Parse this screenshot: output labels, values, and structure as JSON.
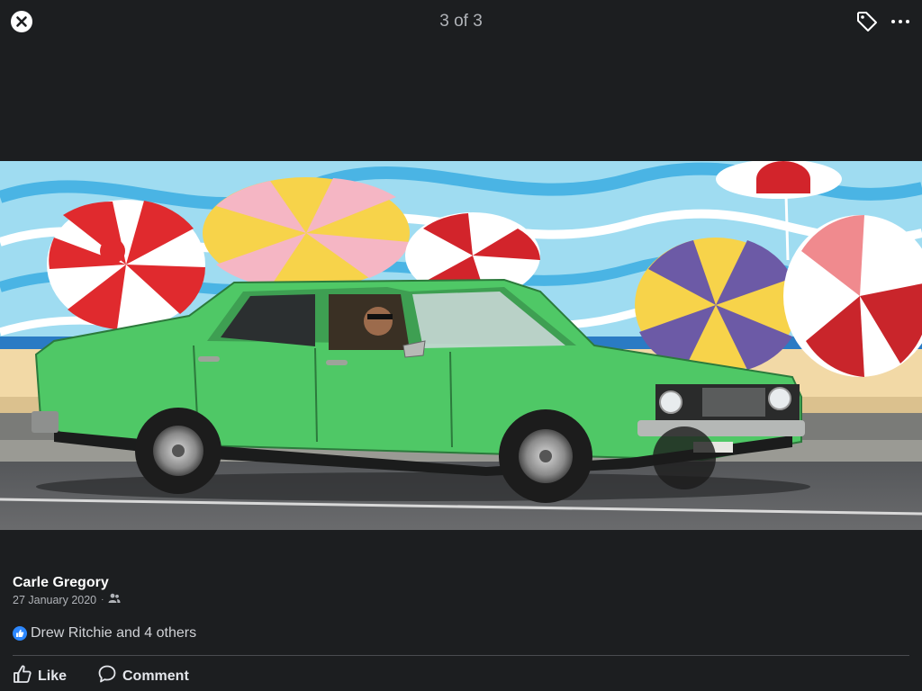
{
  "viewer": {
    "counter": "3 of 3",
    "icons": {
      "close": "close-icon",
      "tag": "tag-icon",
      "more": "more-icon"
    }
  },
  "post": {
    "author": "Carle Gregory",
    "date": "27 January 2020",
    "separator": "·",
    "audience_icon": "friends-icon",
    "reactions_text": "Drew Ritchie and 4 others",
    "like_label": "Like",
    "comment_label": "Comment"
  },
  "colors": {
    "background": "#1c1e20",
    "accent_blue": "#2d88ff",
    "car_green": "#4fc866"
  }
}
